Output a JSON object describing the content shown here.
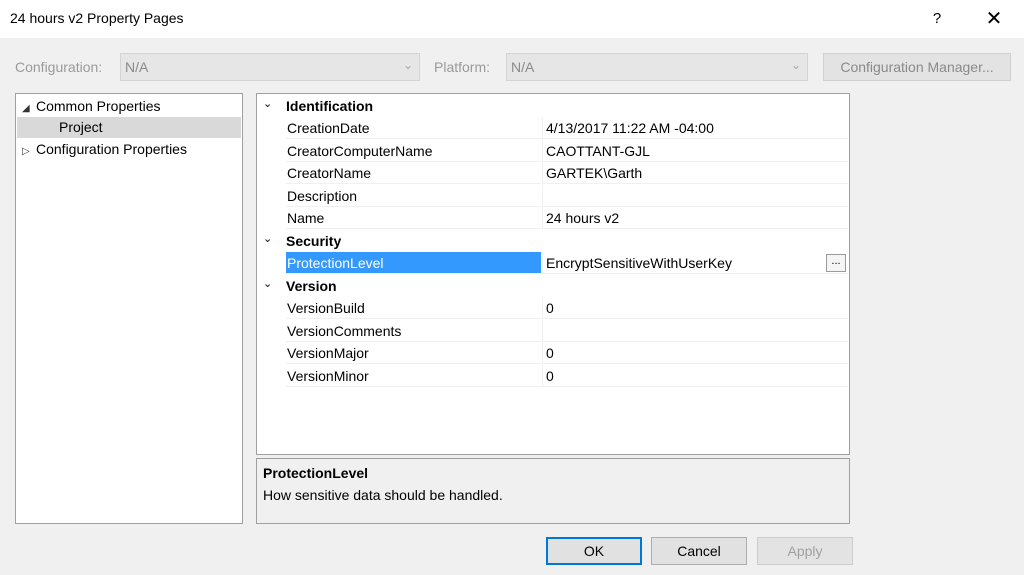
{
  "window": {
    "title": "24 hours v2 Property Pages",
    "help_label": "?",
    "close_label": "✕"
  },
  "config_bar": {
    "configuration_label": "Configuration:",
    "configuration_value": "N/A",
    "platform_label": "Platform:",
    "platform_value": "N/A",
    "config_manager_label": "Configuration Manager..."
  },
  "tree": {
    "items": [
      {
        "label": "Common Properties",
        "expanded": true
      },
      {
        "label": "Project",
        "selected": true
      },
      {
        "label": "Configuration Properties",
        "expanded": false
      }
    ]
  },
  "grid": {
    "categories": [
      {
        "name": "Identification",
        "properties": [
          {
            "name": "CreationDate",
            "value": "4/13/2017 11:22 AM -04:00"
          },
          {
            "name": "CreatorComputerName",
            "value": "CAOTTANT-GJL"
          },
          {
            "name": "CreatorName",
            "value": "GARTEK\\Garth"
          },
          {
            "name": "Description",
            "value": ""
          },
          {
            "name": "Name",
            "value": "24 hours v2"
          }
        ]
      },
      {
        "name": "Security",
        "properties": [
          {
            "name": "ProtectionLevel",
            "value": "EncryptSensitiveWithUserKey",
            "selected": true
          }
        ]
      },
      {
        "name": "Version",
        "properties": [
          {
            "name": "VersionBuild",
            "value": "0"
          },
          {
            "name": "VersionComments",
            "value": ""
          },
          {
            "name": "VersionMajor",
            "value": "0"
          },
          {
            "name": "VersionMinor",
            "value": "0"
          }
        ]
      }
    ],
    "ellipsis_label": "..."
  },
  "description": {
    "title": "ProtectionLevel",
    "text": "How sensitive data should be handled."
  },
  "buttons": {
    "ok": "OK",
    "cancel": "Cancel",
    "apply": "Apply"
  },
  "colors": {
    "selection": "#3399ff",
    "focus_border": "#0078d7"
  }
}
